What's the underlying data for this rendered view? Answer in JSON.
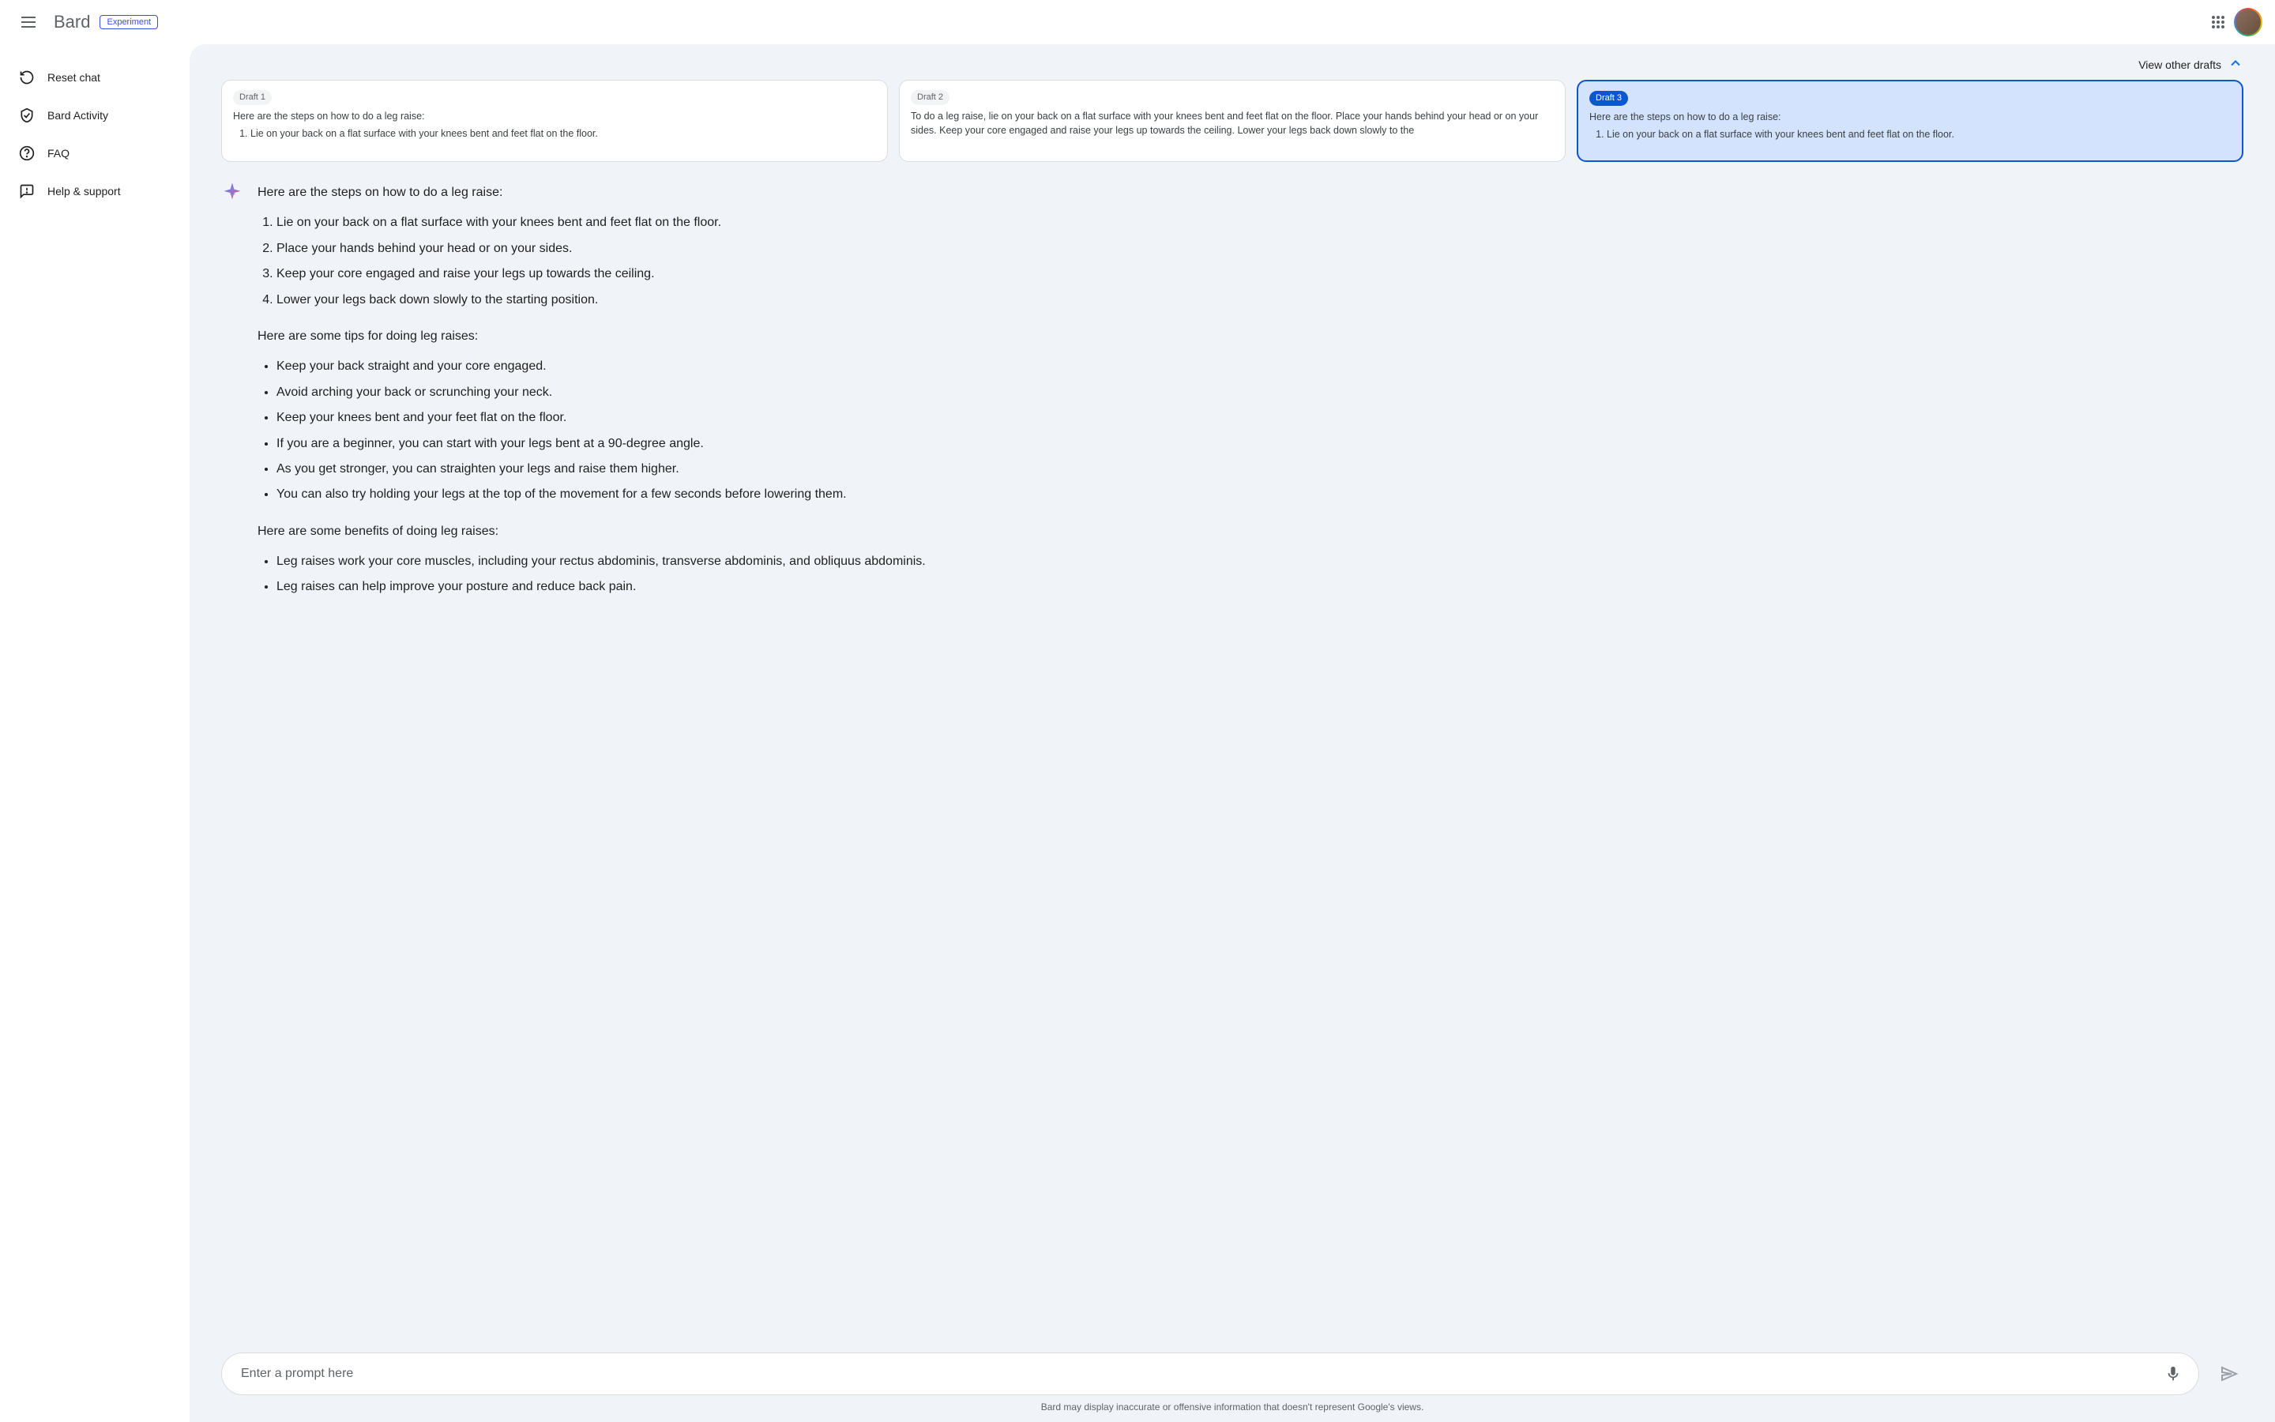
{
  "header": {
    "logo": "Bard",
    "badge": "Experiment"
  },
  "sidebar": {
    "items": [
      {
        "label": "Reset chat"
      },
      {
        "label": "Bard Activity"
      },
      {
        "label": "FAQ"
      },
      {
        "label": "Help & support"
      }
    ]
  },
  "drafts": {
    "toggle_label": "View other drafts",
    "cards": [
      {
        "label": "Draft 1",
        "preview_intro": "Here are the steps on how to do a leg raise:",
        "preview_step1": "Lie on your back on a flat surface with your knees bent and feet flat on the floor."
      },
      {
        "label": "Draft 2",
        "preview_text": "To do a leg raise, lie on your back on a flat surface with your knees bent and feet flat on the floor. Place your hands behind your head or on your sides. Keep your core engaged and raise your legs up towards the ceiling. Lower your legs back down slowly to the"
      },
      {
        "label": "Draft 3",
        "preview_intro": "Here are the steps on how to do a leg raise:",
        "preview_step1": "Lie on your back on a flat surface with your knees bent and feet flat on the floor."
      }
    ]
  },
  "response": {
    "intro": "Here are the steps on how to do a leg raise:",
    "steps": [
      "Lie on your back on a flat surface with your knees bent and feet flat on the floor.",
      "Place your hands behind your head or on your sides.",
      "Keep your core engaged and raise your legs up towards the ceiling.",
      "Lower your legs back down slowly to the starting position."
    ],
    "tips_intro": "Here are some tips for doing leg raises:",
    "tips": [
      "Keep your back straight and your core engaged.",
      "Avoid arching your back or scrunching your neck.",
      "Keep your knees bent and your feet flat on the floor.",
      "If you are a beginner, you can start with your legs bent at a 90-degree angle.",
      "As you get stronger, you can straighten your legs and raise them higher.",
      "You can also try holding your legs at the top of the movement for a few seconds before lowering them."
    ],
    "benefits_intro": "Here are some benefits of doing leg raises:",
    "benefits": [
      "Leg raises work your core muscles, including your rectus abdominis, transverse abdominis, and obliquus abdominis.",
      "Leg raises can help improve your posture and reduce back pain."
    ]
  },
  "input": {
    "placeholder": "Enter a prompt here"
  },
  "disclaimer": "Bard may display inaccurate or offensive information that doesn't represent Google's views."
}
